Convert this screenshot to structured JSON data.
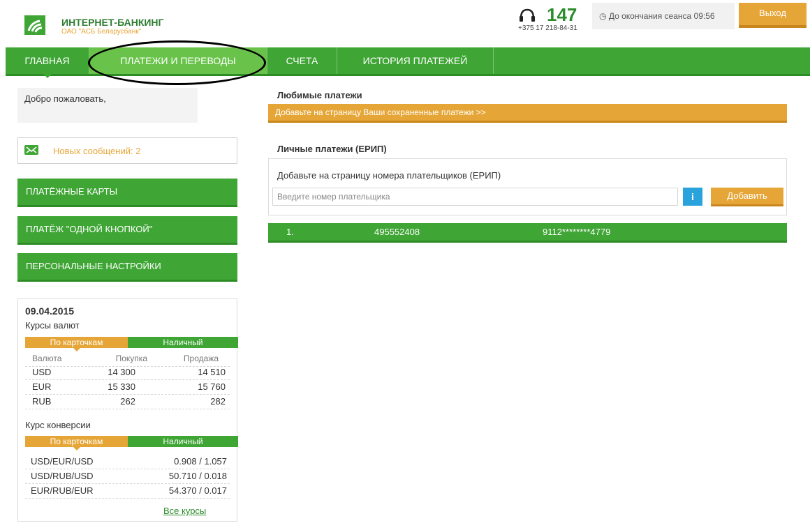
{
  "colors": {
    "green": "#3fa535",
    "dark_green": "#2e8c27",
    "orange": "#e6a637",
    "info_blue": "#2aa3dd"
  },
  "header": {
    "logo_title": "ИНТЕРНЕТ-БАНКИНГ",
    "logo_subtitle": "ОАО \"АСБ Беларусбанк\"",
    "phone_short": "147",
    "phone_full": "+375 17 218-84-31",
    "session_text": "До окончания сеанса 09:56",
    "logout_label": "Выход",
    "icons": {
      "logo": "bank-logo-icon",
      "phone": "headset-icon",
      "clock": "clock-icon"
    }
  },
  "nav": {
    "items": [
      {
        "label": "ГЛАВНАЯ"
      },
      {
        "label": "ПЛАТЕЖИ И ПЕРЕВОДЫ"
      },
      {
        "label": "СЧЕТА"
      },
      {
        "label": "ИСТОРИЯ ПЛАТЕЖЕЙ"
      }
    ]
  },
  "sidebar": {
    "welcome": "Добро пожаловать,",
    "messages_label": "Новых сообщений: 2",
    "buttons": [
      {
        "label": "ПЛАТЁЖНЫЕ КАРТЫ"
      },
      {
        "label": "ПЛАТЁЖ \"ОДНОЙ КНОПКОЙ\""
      },
      {
        "label": "ПЕРСОНАЛЬНЫЕ НАСТРОЙКИ"
      }
    ]
  },
  "rates": {
    "date": "09.04.2015",
    "currency_title": "Курсы валют",
    "tab_cards": "По карточкам",
    "tab_cash": "Наличный",
    "headers": [
      "Валюта",
      "Покупка",
      "Продажа"
    ],
    "rows": [
      {
        "currency": "USD",
        "buy": "14 300",
        "sell": "14 510"
      },
      {
        "currency": "EUR",
        "buy": "15 330",
        "sell": "15 760"
      },
      {
        "currency": "RUB",
        "buy": "262",
        "sell": "282"
      }
    ],
    "conversion_title": "Курс конверсии",
    "conversion_rows": [
      {
        "pair": "USD/EUR/USD",
        "value": "0.908 / 1.057"
      },
      {
        "pair": "USD/RUB/USD",
        "value": "50.710 / 0.018"
      },
      {
        "pair": "EUR/RUB/EUR",
        "value": "54.370 / 0.017"
      }
    ],
    "all_rates_link": "Все курсы"
  },
  "main": {
    "favorites_title": "Любимые платежи",
    "favorites_bar": "Добавьте на страницу Ваши сохраненные платежи >>",
    "erip_title": "Личные платежи (ЕРИП)",
    "erip_hint": "Добавьте на страницу номера плательщиков (ЕРИП)",
    "erip_placeholder": "Введите номер плательщика",
    "info_label": "i",
    "add_label": "Добавить",
    "payments": [
      {
        "index": "1.",
        "payer": "495552408",
        "card": "9112********4779"
      }
    ]
  }
}
